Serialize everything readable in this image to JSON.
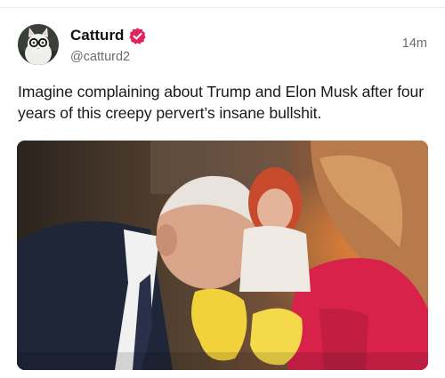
{
  "post": {
    "author": {
      "display_name": "Catturd",
      "handle": "@catturd2",
      "verified": true,
      "avatar_icon": "cat-with-glasses-avatar"
    },
    "timestamp": "14m",
    "text": "Imagine complaining about Trump and Elon Musk after four years of this creepy pervert’s insane bullshit.",
    "media_icon": "photo"
  },
  "colors": {
    "verified_badge": "#e0245e",
    "muted_text": "#6b6b6b",
    "body_text": "#1a1a1a"
  }
}
